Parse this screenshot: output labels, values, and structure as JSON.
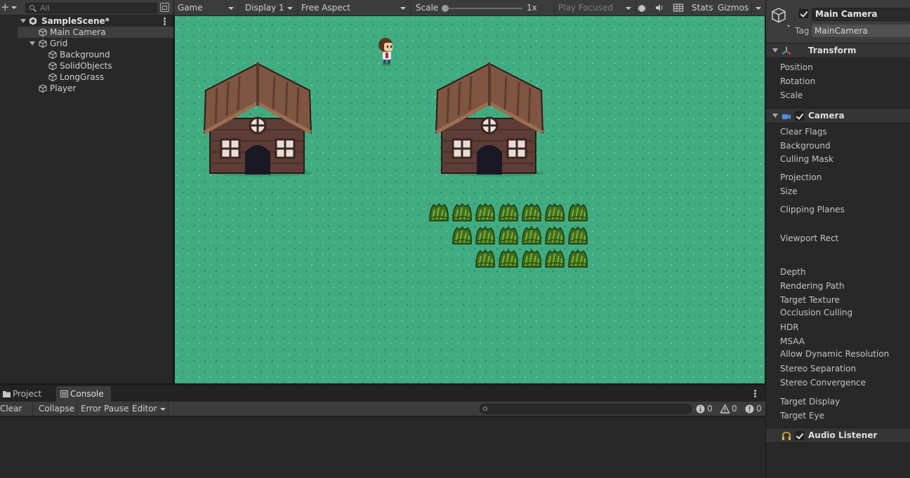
{
  "hierarchy": {
    "search_placeholder": "All",
    "items": [
      {
        "label": "SampleScene*"
      },
      {
        "label": "Main Camera"
      },
      {
        "label": "Grid"
      },
      {
        "label": "Background"
      },
      {
        "label": "SolidObjects"
      },
      {
        "label": "LongGrass"
      },
      {
        "label": "Player"
      }
    ]
  },
  "game_toolbar": {
    "view": "Game",
    "display": "Display 1",
    "aspect": "Free Aspect",
    "scale_label": "Scale",
    "scale_value": "1x",
    "scale_fraction": 0.0,
    "play_mode": "Play Focused",
    "stats": "Stats",
    "gizmos": "Gizmos"
  },
  "inspector": {
    "object_name": "Main Camera",
    "tag_label": "Tag",
    "tag_value": "MainCamera",
    "transform": {
      "title": "Transform",
      "props": [
        "Position",
        "Rotation",
        "Scale"
      ]
    },
    "camera": {
      "title": "Camera",
      "props": [
        "Clear Flags",
        "Background",
        "Culling Mask",
        "Projection",
        "Size",
        "Clipping Planes",
        "Viewport Rect",
        "Depth",
        "Rendering Path",
        "Target Texture",
        "Occlusion Culling",
        "HDR",
        "MSAA",
        "Allow Dynamic Resolution",
        "Stereo Separation",
        "Stereo Convergence",
        "Target Display",
        "Target Eye"
      ]
    },
    "audio_listener": {
      "title": "Audio Listener"
    }
  },
  "bottom": {
    "tabs": [
      "Project",
      "Console"
    ],
    "console": {
      "clear": "Clear",
      "collapse": "Collapse",
      "error_pause": "Error Pause",
      "editor": "Editor",
      "info_count": "0",
      "warning_count": "0",
      "error_count": "0"
    }
  },
  "colors": {
    "grass": "#41ac82",
    "panel": "#282828",
    "toolbar": "#3c3c3c",
    "camera_icon": "#4c8fd6"
  }
}
